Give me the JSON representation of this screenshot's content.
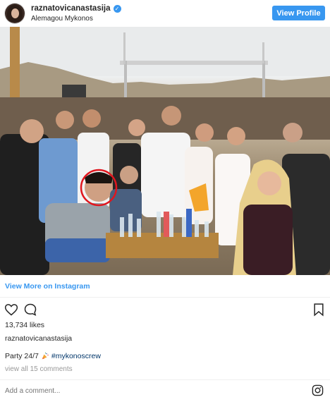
{
  "header": {
    "username": "raznatovicanastasija",
    "location": "Alemagou Mykonos",
    "view_profile_label": "View Profile",
    "verified_glyph": "✓"
  },
  "photo": {
    "alt_icon": "group-photo-image",
    "highlight_color": "#e0161e"
  },
  "post": {
    "view_more_label": "View More on Instagram",
    "likes": "13,734 likes",
    "caption_user": "raznatovicanastasija",
    "caption_text": "Party 24/7",
    "caption_hashtag": "#mykonoscrew",
    "view_comments": "view all 15 comments",
    "add_comment_placeholder": "Add a comment..."
  },
  "icons": {
    "like": "heart-icon",
    "comment": "comment-bubble-icon",
    "save": "bookmark-icon",
    "party": "party-popper-icon",
    "instagram": "instagram-logo-icon"
  },
  "colors": {
    "accent": "#3897f0",
    "text": "#262626",
    "muted": "#999999",
    "hashtag": "#003569"
  }
}
